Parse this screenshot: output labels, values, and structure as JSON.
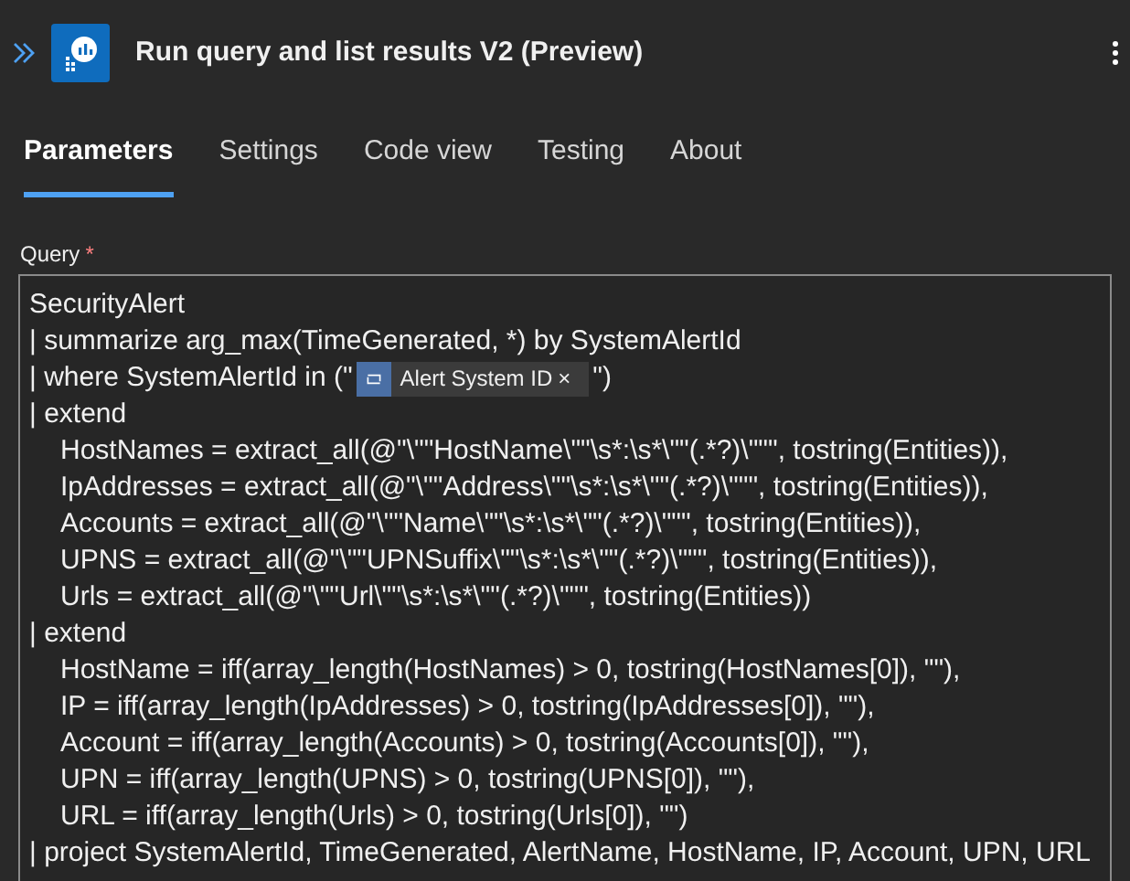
{
  "header": {
    "title": "Run query and list results V2 (Preview)"
  },
  "tabs": [
    {
      "label": "Parameters",
      "selected": true
    },
    {
      "label": "Settings",
      "selected": false
    },
    {
      "label": "Code view",
      "selected": false
    },
    {
      "label": "Testing",
      "selected": false
    },
    {
      "label": "About",
      "selected": false
    }
  ],
  "query": {
    "label": "Query",
    "required_mark": "*",
    "lines": [
      {
        "kind": "text",
        "text": "SecurityAlert"
      },
      {
        "kind": "text",
        "text": "| summarize arg_max(TimeGenerated, *) by SystemAlertId"
      },
      {
        "kind": "token",
        "before": "| where SystemAlertId in (\"",
        "token": "Alert System ID",
        "remove": "×",
        "after": "\")"
      },
      {
        "kind": "text",
        "text": "| extend",
        "children": [
          {
            "kind": "text",
            "text": "HostNames = extract_all(@\"\\\"\"HostName\\\"\"\\s*:\\s*\\\"\"(.*?)\\\"\"\", tostring(Entities)),"
          },
          {
            "kind": "text",
            "text": "IpAddresses = extract_all(@\"\\\"\"Address\\\"\"\\s*:\\s*\\\"\"(.*?)\\\"\"\", tostring(Entities)),"
          },
          {
            "kind": "text",
            "text": "Accounts = extract_all(@\"\\\"\"Name\\\"\"\\s*:\\s*\\\"\"(.*?)\\\"\"\", tostring(Entities)),"
          },
          {
            "kind": "text",
            "text": "UPNS = extract_all(@\"\\\"\"UPNSuffix\\\"\"\\s*:\\s*\\\"\"(.*?)\\\"\"\", tostring(Entities)),"
          },
          {
            "kind": "text",
            "text": "Urls = extract_all(@\"\\\"\"Url\\\"\"\\s*:\\s*\\\"\"(.*?)\\\"\"\", tostring(Entities))"
          }
        ]
      },
      {
        "kind": "text",
        "text": "| extend",
        "children": [
          {
            "kind": "text",
            "text": "HostName = iff(array_length(HostNames) > 0, tostring(HostNames[0]), \"\"),"
          },
          {
            "kind": "text",
            "text": "IP = iff(array_length(IpAddresses) > 0, tostring(IpAddresses[0]), \"\"),"
          },
          {
            "kind": "text",
            "text": "Account = iff(array_length(Accounts) > 0, tostring(Accounts[0]), \"\"),"
          },
          {
            "kind": "text",
            "text": "UPN = iff(array_length(UPNS) > 0, tostring(UPNS[0]), \"\"),"
          },
          {
            "kind": "text",
            "text": "URL = iff(array_length(Urls) > 0, tostring(Urls[0]), \"\")"
          }
        ]
      },
      {
        "kind": "text",
        "text": "| project SystemAlertId, TimeGenerated, AlertName, HostName, IP, Account, UPN, URL"
      }
    ]
  }
}
